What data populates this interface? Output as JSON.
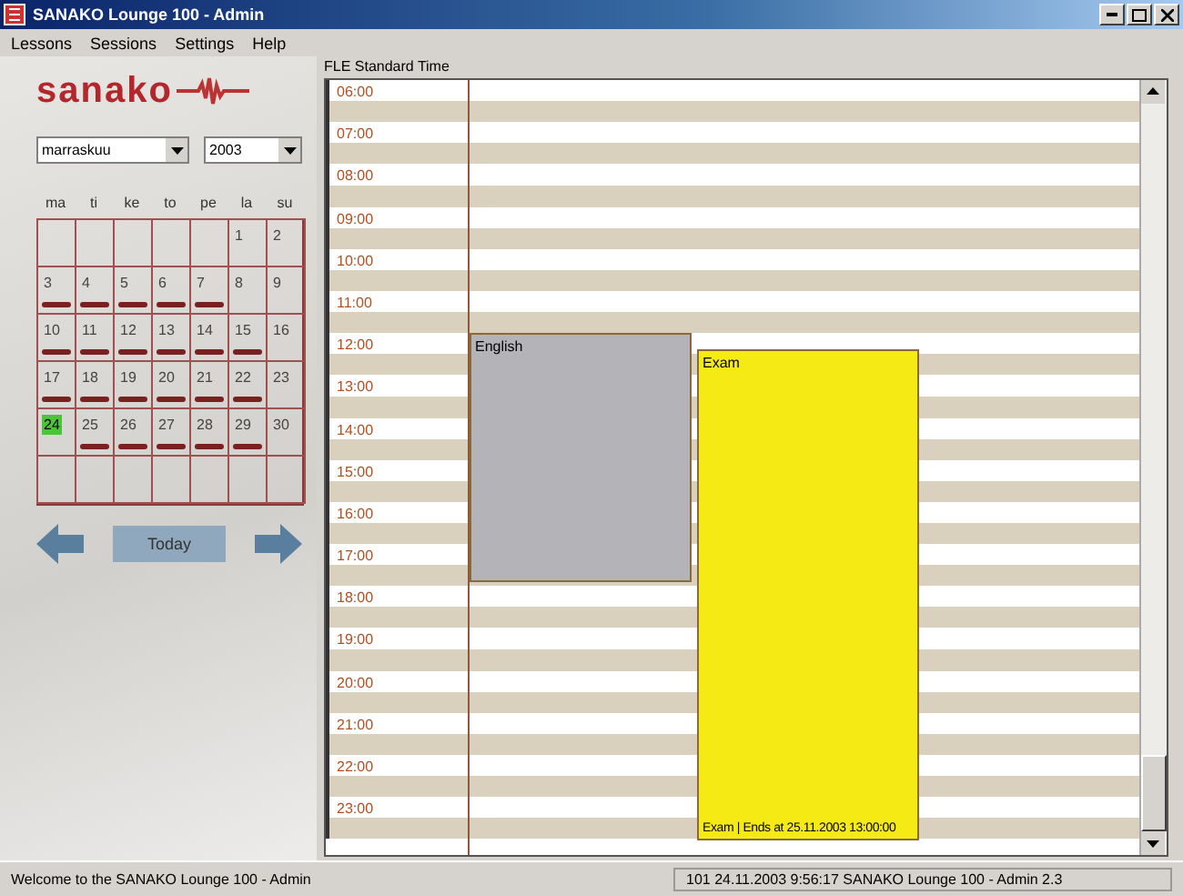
{
  "window": {
    "title": "SANAKO Lounge 100 - Admin"
  },
  "menu": [
    "Lessons",
    "Sessions",
    "Settings",
    "Help"
  ],
  "logo": {
    "text": "sanako"
  },
  "month_select": {
    "value": "marraskuu"
  },
  "year_select": {
    "value": "2003"
  },
  "weekdays": [
    "ma",
    "ti",
    "ke",
    "to",
    "pe",
    "la",
    "su"
  ],
  "weeks": [
    [
      {
        "day": "1",
        "today": false,
        "has_event": false
      },
      {
        "day": "2",
        "today": false,
        "has_event": false
      }
    ],
    [
      {
        "day": "3",
        "today": false,
        "has_event": true
      },
      {
        "day": "4",
        "today": false,
        "has_event": true
      },
      {
        "day": "5",
        "today": false,
        "has_event": true
      },
      {
        "day": "6",
        "today": false,
        "has_event": true
      },
      {
        "day": "7",
        "today": false,
        "has_event": true
      },
      {
        "day": "8",
        "today": false,
        "has_event": false
      },
      {
        "day": "9",
        "today": false,
        "has_event": false
      }
    ],
    [
      {
        "day": "10",
        "today": false,
        "has_event": true
      },
      {
        "day": "11",
        "today": false,
        "has_event": true
      },
      {
        "day": "12",
        "today": false,
        "has_event": true
      },
      {
        "day": "13",
        "today": false,
        "has_event": true
      },
      {
        "day": "14",
        "today": false,
        "has_event": true
      },
      {
        "day": "15",
        "today": false,
        "has_event": true
      },
      {
        "day": "16",
        "today": false,
        "has_event": false
      }
    ],
    [
      {
        "day": "17",
        "today": false,
        "has_event": true
      },
      {
        "day": "18",
        "today": false,
        "has_event": true
      },
      {
        "day": "19",
        "today": false,
        "has_event": true
      },
      {
        "day": "20",
        "today": false,
        "has_event": true
      },
      {
        "day": "21",
        "today": false,
        "has_event": true
      },
      {
        "day": "22",
        "today": false,
        "has_event": true
      },
      {
        "day": "23",
        "today": false,
        "has_event": false
      }
    ],
    [
      {
        "day": "24",
        "today": true,
        "has_event": false
      },
      {
        "day": "25",
        "today": false,
        "has_event": true
      },
      {
        "day": "26",
        "today": false,
        "has_event": true
      },
      {
        "day": "27",
        "today": false,
        "has_event": true
      },
      {
        "day": "28",
        "today": false,
        "has_event": true
      },
      {
        "day": "29",
        "today": false,
        "has_event": true
      },
      {
        "day": "30",
        "today": false,
        "has_event": false
      }
    ]
  ],
  "today_button": "Today",
  "schedule": {
    "timezone": "FLE Standard Time",
    "hours": [
      "06:00",
      "07:00",
      "08:00",
      "09:00",
      "10:00",
      "11:00",
      "12:00",
      "13:00",
      "14:00",
      "15:00",
      "16:00",
      "17:00",
      "18:00",
      "19:00",
      "20:00",
      "21:00",
      "22:00",
      "23:00"
    ],
    "events": [
      {
        "title": "English",
        "color": "#b4b4b8"
      },
      {
        "title": "Exam",
        "footer": "Exam | Ends at 25.11.2003 13:00:00",
        "color": "#f5ea14"
      }
    ]
  },
  "status_bar": {
    "left": "Welcome to the SANAKO Lounge 100 - Admin",
    "right": "101 24.11.2003 9:56:17 SANAKO Lounge 100 - Admin 2.3"
  }
}
